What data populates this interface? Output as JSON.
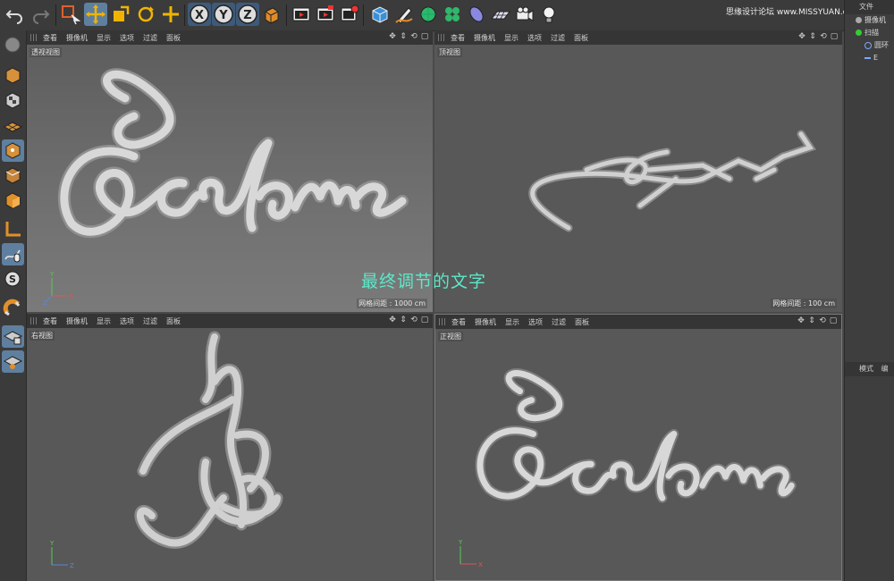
{
  "watermark": "思缘设计论坛 www.MISSYUAN.com",
  "caption": "最终调节的文字",
  "viewport_menu": [
    "查看",
    "摄像机",
    "显示",
    "选项",
    "过滤",
    "面板"
  ],
  "viewports": [
    {
      "id": "perspective",
      "label": "透视视图",
      "grid": "网格间距 : 1000 cm"
    },
    {
      "id": "top",
      "label": "顶视图",
      "grid": "网格间距 : 100 cm"
    },
    {
      "id": "right",
      "label": "右视图",
      "grid": ""
    },
    {
      "id": "front",
      "label": "正视图",
      "grid": ""
    }
  ],
  "object_manager": {
    "header": "文件",
    "items": [
      {
        "label": "摄像机",
        "icon": "camera-icon"
      },
      {
        "label": "扫描",
        "icon": "sweep-icon"
      },
      {
        "label": "圆环",
        "icon": "circle-spline-icon"
      },
      {
        "label": "E",
        "icon": "spline-icon"
      }
    ],
    "attr_tabs": [
      "模式",
      "编"
    ]
  },
  "axis_labels": {
    "x": "X",
    "y": "Y",
    "z": "Z"
  },
  "toolbar_icons": [
    "undo-icon",
    "redo-icon",
    "live-select-icon",
    "move-icon",
    "scale-icon",
    "rotate-icon",
    "add-icon",
    "x-axis-icon",
    "y-axis-icon",
    "z-axis-icon",
    "coordinate-system-icon",
    "render-view-icon",
    "render-picture-viewer-icon",
    "render-settings-icon",
    "cube-icon",
    "pen-icon",
    "subdivision-icon",
    "array-icon",
    "deformer-icon",
    "floor-icon",
    "camera-icon",
    "light-icon"
  ],
  "accent_color": "#5f7f9f",
  "caption_color": "#5ce8c8"
}
